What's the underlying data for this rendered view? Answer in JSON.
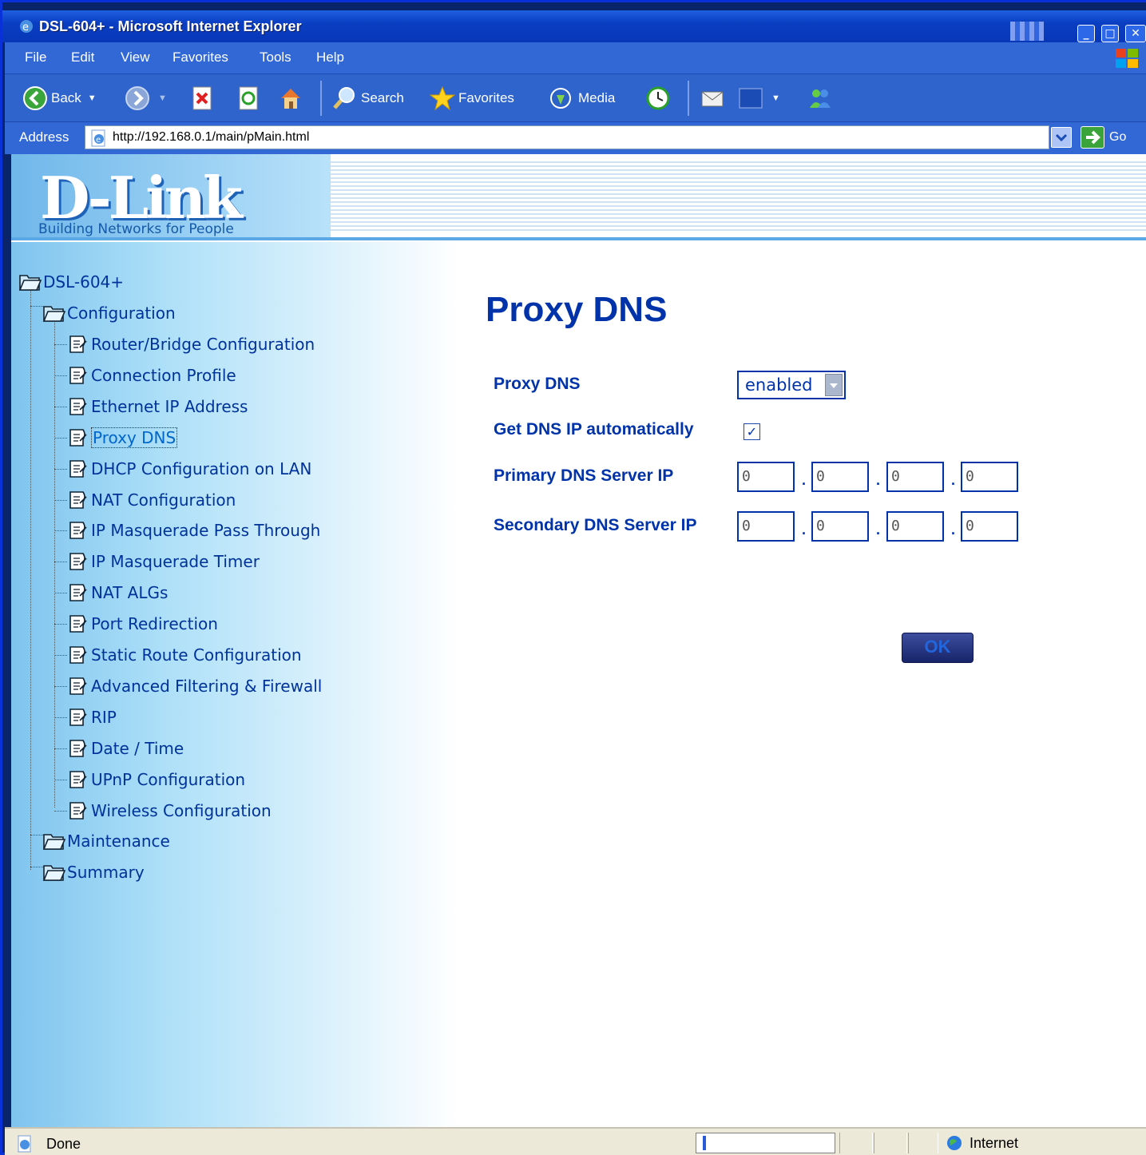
{
  "window": {
    "title": "DSL-604+ - Microsoft Internet Explorer"
  },
  "menu": [
    "File",
    "Edit",
    "View",
    "Favorites",
    "Tools",
    "Help"
  ],
  "toolbar": {
    "back_label": "Back",
    "search_label": "Search",
    "favorites_label": "Favorites",
    "media_label": "Media"
  },
  "address": {
    "label": "Address",
    "url": "http://192.168.0.1/main/pMain.html",
    "go_label": "Go"
  },
  "header": {
    "logo_text": "D-Link",
    "tagline": "Building Networks for People"
  },
  "tree": {
    "root": "DSL-604+",
    "configuration": "Configuration",
    "items": [
      "Router/Bridge Configuration",
      "Connection Profile",
      "Ethernet IP Address",
      "Proxy DNS",
      "DHCP Configuration on LAN",
      "NAT Configuration",
      "IP Masquerade Pass Through",
      "IP Masquerade Timer",
      "NAT ALGs",
      "Port Redirection",
      "Static Route Configuration",
      "Advanced Filtering & Firewall",
      "RIP",
      "Date / Time",
      "UPnP Configuration",
      "Wireless Configuration"
    ],
    "active_item": "Proxy DNS",
    "maintenance": "Maintenance",
    "summary": "Summary"
  },
  "form": {
    "title": "Proxy DNS",
    "proxy_dns_label": "Proxy DNS",
    "proxy_dns_value": "enabled",
    "auto_label": "Get DNS IP automatically",
    "auto_checked": true,
    "primary_label": "Primary DNS Server IP",
    "primary_ip": [
      "0",
      "0",
      "0",
      "0"
    ],
    "secondary_label": "Secondary DNS Server IP",
    "secondary_ip": [
      "0",
      "0",
      "0",
      "0"
    ],
    "ok_label": "OK"
  },
  "status": {
    "text": "Done",
    "zone": "Internet"
  },
  "colors": {
    "xp_blue": "#3168d5",
    "form_blue": "#0033aa",
    "sidebar": "#7fc4ee"
  }
}
